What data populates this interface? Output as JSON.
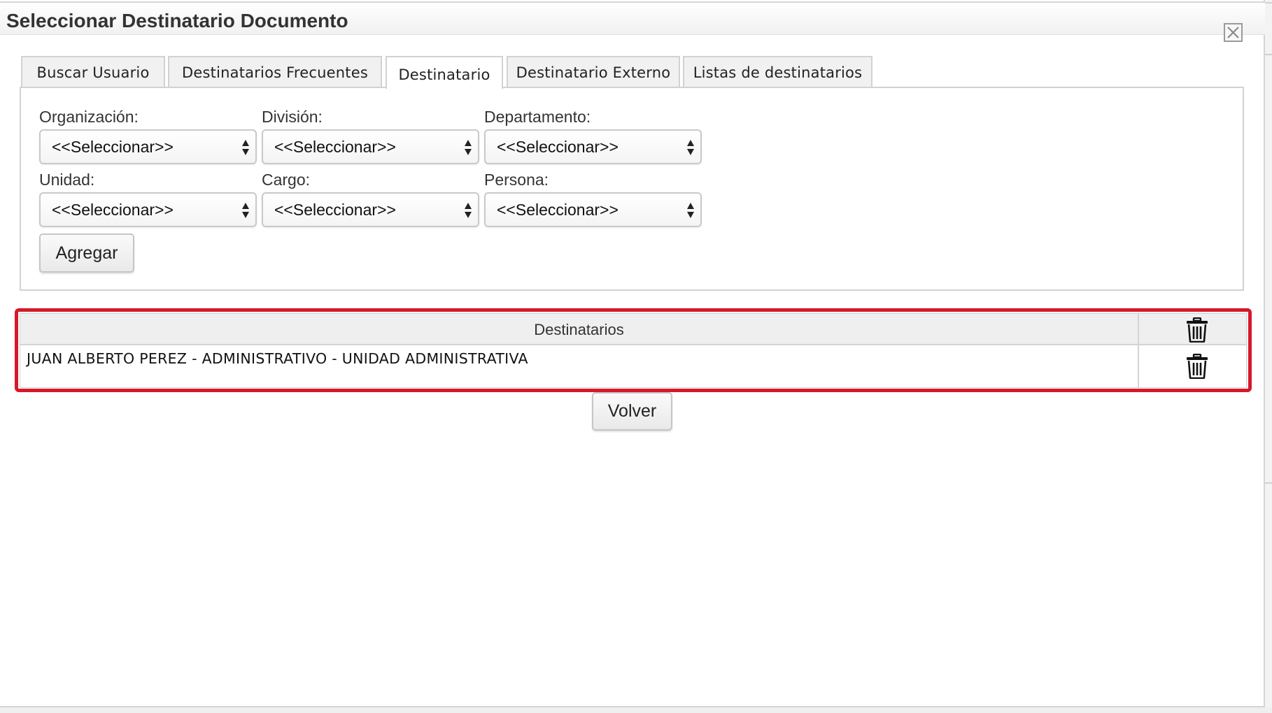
{
  "dialog": {
    "title": "Seleccionar Destinatario Documento",
    "close_icon": "close-icon"
  },
  "tabs": [
    {
      "label": "Buscar Usuario",
      "active": false
    },
    {
      "label": "Destinatarios Frecuentes",
      "active": false
    },
    {
      "label": "Destinatario",
      "active": true
    },
    {
      "label": "Destinatario Externo",
      "active": false
    },
    {
      "label": "Listas de destinatarios",
      "active": false
    }
  ],
  "form": {
    "organizacion": {
      "label": "Organización:",
      "value": "<<Seleccionar>>"
    },
    "division": {
      "label": "División:",
      "value": "<<Seleccionar>>"
    },
    "departamento": {
      "label": "Departamento:",
      "value": "<<Seleccionar>>"
    },
    "unidad": {
      "label": "Unidad:",
      "value": "<<Seleccionar>>"
    },
    "cargo": {
      "label": "Cargo:",
      "value": "<<Seleccionar>>"
    },
    "persona": {
      "label": "Persona:",
      "value": "<<Seleccionar>>"
    },
    "add_button": "Agregar"
  },
  "recipients": {
    "header": "Destinatarios",
    "delete_icon": "trash-icon",
    "rows": [
      {
        "text": "JUAN ALBERTO PEREZ - ADMINISTRATIVO - UNIDAD ADMINISTRATIVA"
      }
    ]
  },
  "back_button": "Volver",
  "colors": {
    "highlight": "#d7182a",
    "border": "#d2d2d2",
    "header_bg": "#efefef"
  }
}
